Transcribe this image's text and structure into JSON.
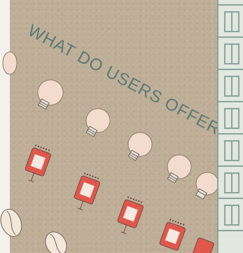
{
  "title": "WHAT DO USERS OFFER?",
  "colors": {
    "wall": "#bfae97",
    "heading": "#5a7a74",
    "bulb": "#f3dccd",
    "sign": "#e0574c",
    "building": "#e2e8df",
    "building_line": "#8aa49c"
  },
  "icons": [
    "lightbulb-icon",
    "red-sign-icon",
    "coffee-bean-icon"
  ]
}
